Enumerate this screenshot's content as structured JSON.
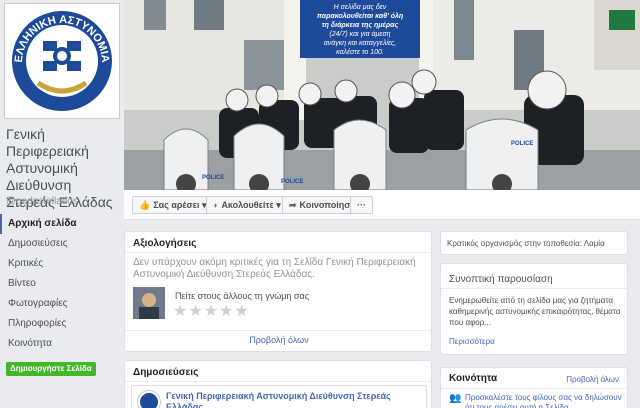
{
  "page": {
    "name": "Γενική Περιφερειακή Αστυνομική Διεύθυνση Στερεάς Ελλάδας",
    "handle": "@gadpstellados",
    "logo_text": "ΕΛΛΗΝΙΚΗ ΑΣΤΥΝΟΜΙΑ"
  },
  "nav": {
    "items": [
      {
        "label": "Αρχική σελίδα"
      },
      {
        "label": "Δημοσιεύσεις"
      },
      {
        "label": "Κριτικές"
      },
      {
        "label": "Βίντεο"
      },
      {
        "label": "Φωτογραφίες"
      },
      {
        "label": "Πληροφορίες"
      },
      {
        "label": "Κοινότητα"
      }
    ],
    "create_page": "Δημιουργήστε Σελίδα"
  },
  "cover": {
    "line1": "Η σελίδα μας δεν",
    "line2": "παρακολουθείται καθ' όλη",
    "line3": "τη διάρκεια της ημέρας",
    "line4": "(24/7) και για άμεση",
    "line5": "ανάγκη και καταγγελίες,",
    "line6": "καλέστε το 100.",
    "moto_left": "POLICE",
    "moto_mid": "POLICE",
    "moto_right": "POLICE"
  },
  "actions": {
    "like": "Σας αρέσει",
    "follow": "Ακολουθείτε",
    "share": "Κοινοποίηση",
    "more": "···"
  },
  "reviews": {
    "title": "Αξιολογήσεις",
    "empty": "Δεν υπάρχουν ακόμη κριτικές για τη Σελίδα Γενική Περιφερειακή Αστυνομική Διεύθυνση Στερεάς Ελλάδας.",
    "prompt": "Πείτε στους άλλους τη γνώμη σας",
    "see_all": "Προβολή όλων"
  },
  "posts": {
    "title": "Δημοσιεύσεις",
    "author": "Γενική Περιφερειακή Αστυνομική Διεύθυνση Στερεάς Ελλάδας"
  },
  "right": {
    "org": "Κρατικός οργανισμός στην τοποθεσία: Λαμία",
    "summary_title": "Συνοπτική παρουσίαση",
    "summary_text": "Ενημερωθείτε από τη σελίδα μας για ζητήματα καθημερινής αστυνομικής επικαιρότητας, θέματα που αφορ...",
    "more": "Περισσότερα",
    "community_title": "Κοινότητα",
    "community_see_all": "Προβολή όλων",
    "community_invite": "Προσκαλέστε τους φίλους σας να δηλώσουν ότι τους αρέσει αυτή η Σελίδα"
  },
  "colors": {
    "fb_blue": "#4267b2",
    "police_blue": "#1e4a9a",
    "create_green": "#42b72a"
  }
}
